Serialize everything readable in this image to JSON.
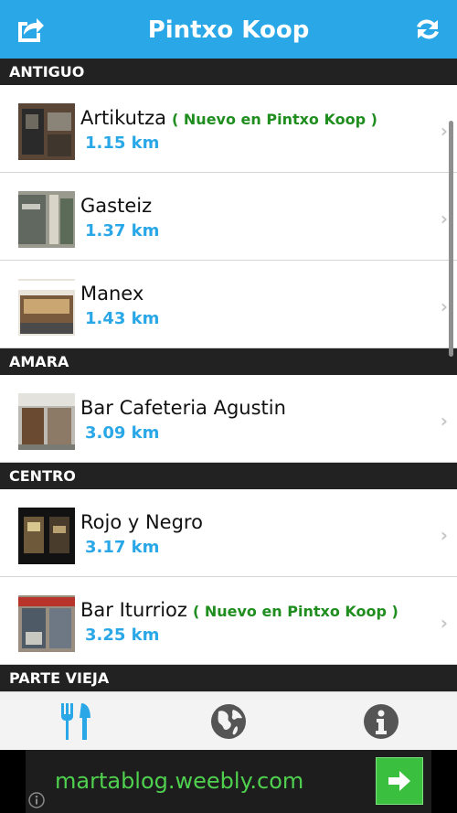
{
  "header": {
    "title": "Pintxo Koop",
    "share_icon": "share-icon",
    "refresh_icon": "refresh-icon"
  },
  "sections": [
    {
      "name": "ANTIGUO",
      "items": [
        {
          "name": "Artikutza",
          "badge": "( Nuevo en Pintxo Koop )",
          "distance": "1.15 km"
        },
        {
          "name": "Gasteiz",
          "badge": "",
          "distance": "1.37 km"
        },
        {
          "name": "Manex",
          "badge": "",
          "distance": "1.43 km"
        }
      ]
    },
    {
      "name": "AMARA",
      "items": [
        {
          "name": "Bar Cafeteria Agustin",
          "badge": "",
          "distance": "3.09 km"
        }
      ]
    },
    {
      "name": "CENTRO",
      "items": [
        {
          "name": "Rojo y Negro",
          "badge": "",
          "distance": "3.17 km"
        },
        {
          "name": "Bar Iturrioz",
          "badge": "( Nuevo en Pintxo Koop )",
          "distance": "3.25 km"
        }
      ]
    },
    {
      "name": "PARTE VIEJA",
      "items": []
    }
  ],
  "tabs": [
    {
      "icon": "fork-knife-icon",
      "active": true
    },
    {
      "icon": "globe-icon",
      "active": false
    },
    {
      "icon": "info-icon",
      "active": false
    }
  ],
  "ad": {
    "text": "martablog.weebly.com",
    "arrow_icon": "arrow-right-icon",
    "info_icon": "info-icon"
  },
  "colors": {
    "accent": "#2aa7e6",
    "section_bg": "#222222",
    "badge": "#1f8e1f",
    "ad_text": "#4fd14f"
  }
}
